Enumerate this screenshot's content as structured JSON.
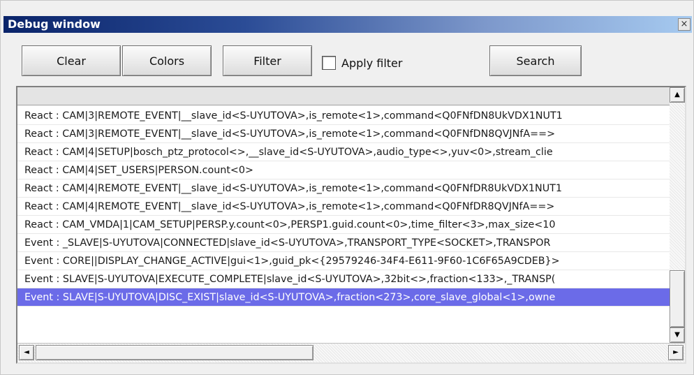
{
  "window": {
    "title": "Debug window",
    "close_glyph": "×"
  },
  "toolbar": {
    "clear_label": "Clear",
    "colors_label": "Colors",
    "filter_label": "Filter",
    "apply_filter_label": "Apply filter",
    "apply_filter_checked": false,
    "search_label": "Search"
  },
  "log": {
    "rows": [
      "React : CAM|3|REMOTE_EVENT|__slave_id<S-UYUTOVA>,is_remote<1>,command<Q0FNfDN8UkVDX1NUT1",
      "React : CAM|3|REMOTE_EVENT|__slave_id<S-UYUTOVA>,is_remote<1>,command<Q0FNfDN8QVJNfA==>",
      "React : CAM|4|SETUP|bosch_ptz_protocol<>,__slave_id<S-UYUTOVA>,audio_type<>,yuv<0>,stream_clie",
      "React : CAM|4|SET_USERS|PERSON.count<0>",
      "React : CAM|4|REMOTE_EVENT|__slave_id<S-UYUTOVA>,is_remote<1>,command<Q0FNfDR8UkVDX1NUT1",
      "React : CAM|4|REMOTE_EVENT|__slave_id<S-UYUTOVA>,is_remote<1>,command<Q0FNfDR8QVJNfA==>",
      "React : CAM_VMDA|1|CAM_SETUP|PERSP.y.count<0>,PERSP1.guid.count<0>,time_filter<3>,max_size<10",
      "Event : _SLAVE|S-UYUTOVA|CONNECTED|slave_id<S-UYUTOVA>,TRANSPORT_TYPE<SOCKET>,TRANSPOR",
      "Event : CORE||DISPLAY_CHANGE_ACTIVE|gui<1>,guid_pk<{29579246-34F4-E611-9F60-1C6F65A9CDEB}>",
      "Event : SLAVE|S-UYUTOVA|EXECUTE_COMPLETE|slave_id<S-UYUTOVA>,32bit<>,fraction<133>,_TRANSP(",
      "Event : SLAVE|S-UYUTOVA|DISC_EXIST|slave_id<S-UYUTOVA>,fraction<273>,core_slave_global<1>,owne"
    ],
    "selected_index": 10
  },
  "scrollbars": {
    "up_glyph": "▲",
    "down_glyph": "▼",
    "left_glyph": "◄",
    "right_glyph": "►"
  }
}
